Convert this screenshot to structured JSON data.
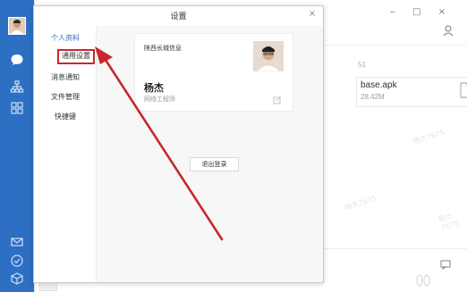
{
  "dialog": {
    "title": "设置",
    "close_symbol": "×",
    "nav": [
      "个人资料",
      "通用设置",
      "消息通知",
      "文件管理",
      "快捷键"
    ],
    "active_index": 0,
    "highlighted_index": 1
  },
  "profile": {
    "company": "陕西长城信息",
    "name": "杨杰",
    "title": "网络工程师"
  },
  "logout_label": "退出登录",
  "background": {
    "window_controls": "‒  □  ×",
    "time_fragment": "51",
    "file_name": "base.apk",
    "file_size": "28.42M",
    "watermark": "杨杰7675"
  },
  "colors": {
    "rail": "#2d6fc2",
    "accent": "#2d6fc2",
    "annotation": "#c8272e"
  },
  "icons": {
    "rail": [
      "chat-icon",
      "org-icon",
      "apps-icon",
      "mail-icon",
      "check-icon",
      "cube-icon"
    ]
  }
}
